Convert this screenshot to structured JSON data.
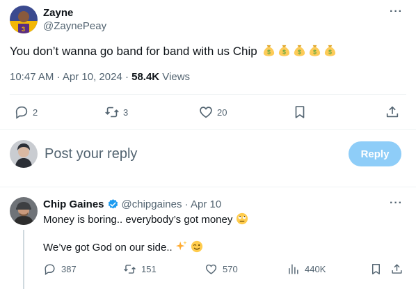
{
  "tweet": {
    "author_name": "Zayne",
    "author_handle": "@ZaynePeay",
    "text": "You don’t wanna go band for band with us Chip",
    "emoji": [
      "money-bag",
      "money-bag",
      "money-bag",
      "money-bag",
      "money-bag"
    ],
    "time": "10:47 AM · Apr 10, 2024 · ",
    "views_count": "58.4K",
    "views_label": " Views",
    "actions": {
      "replies": "2",
      "reposts": "3",
      "likes": "20"
    }
  },
  "reply_box": {
    "placeholder": "Post your reply",
    "button_label": "Reply"
  },
  "reply": {
    "author_name": "Chip Gaines",
    "author_handle": "@chipgaines · Apr 10",
    "line1": "Money is boring.. everybody’s got money",
    "line2": "We’ve got God on our side..",
    "actions": {
      "replies": "387",
      "reposts": "151",
      "likes": "570",
      "views": "440K"
    }
  },
  "colors": {
    "text": "#0f1419",
    "secondary": "#536471",
    "reply_button": "#8ecdf8",
    "verified": "#1d9bf0"
  }
}
